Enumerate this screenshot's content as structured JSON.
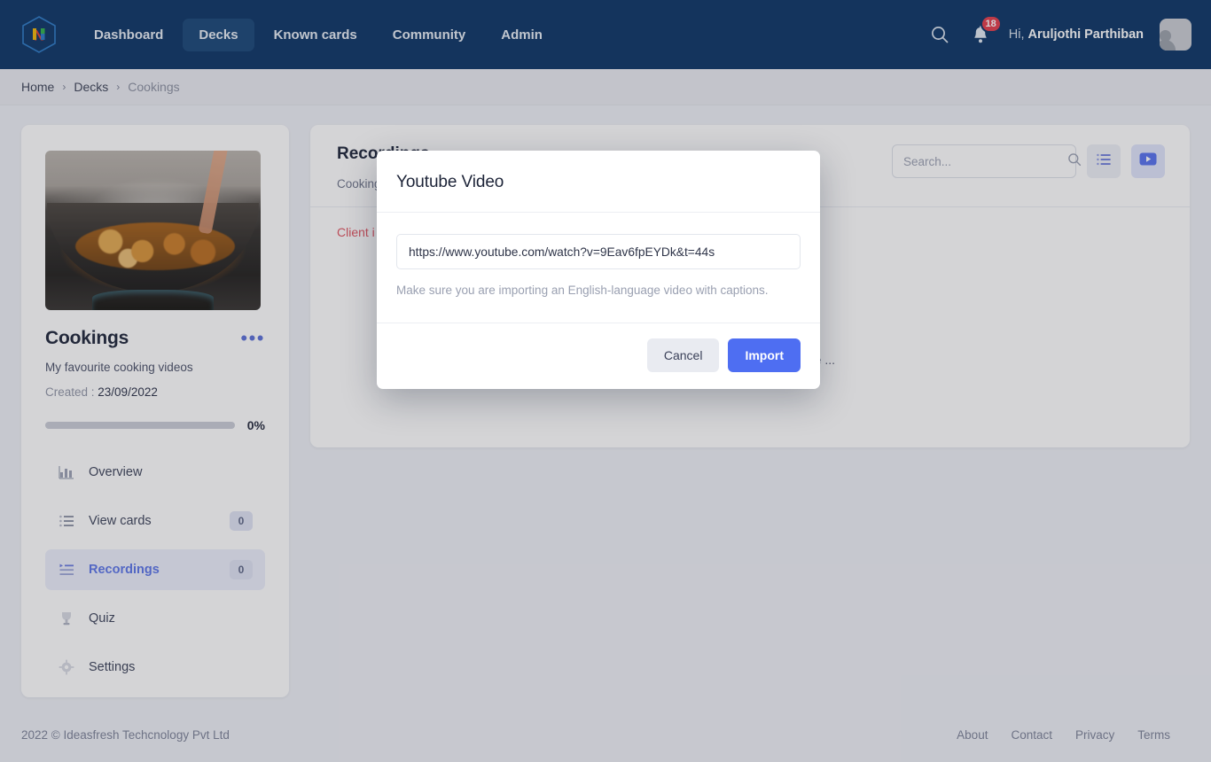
{
  "header": {
    "logo_letter": "N",
    "nav": [
      {
        "label": "Dashboard",
        "active": false
      },
      {
        "label": "Decks",
        "active": true
      },
      {
        "label": "Known cards",
        "active": false
      },
      {
        "label": "Community",
        "active": false
      },
      {
        "label": "Admin",
        "active": false
      }
    ],
    "notification_count": "18",
    "greeting_prefix": "Hi, ",
    "user_name": "Aruljothi Parthiban"
  },
  "breadcrumb": {
    "items": [
      "Home",
      "Decks",
      "Cookings"
    ],
    "separator": "›"
  },
  "sidebar": {
    "deck_title": "Cookings",
    "deck_description": "My favourite cooking videos",
    "created_label": "Created : ",
    "created_date": "23/09/2022",
    "progress_percent": "0%",
    "progress_value": 0,
    "menu": [
      {
        "label": "Overview",
        "icon": "bar-chart-icon",
        "badge": null,
        "active": false
      },
      {
        "label": "View cards",
        "icon": "list-icon",
        "badge": "0",
        "active": false
      },
      {
        "label": "Recordings",
        "icon": "playlist-icon",
        "badge": "0",
        "active": true
      },
      {
        "label": "Quiz",
        "icon": "trophy-icon",
        "badge": null,
        "active": false
      },
      {
        "label": "Settings",
        "icon": "gear-icon",
        "badge": null,
        "active": false
      }
    ]
  },
  "main": {
    "title": "Recordings",
    "subtitle": "Cooking",
    "error_text": "Client i",
    "empty_text": "ere ...",
    "search_placeholder": "Search...",
    "tools": [
      {
        "name": "list-view-button",
        "icon": "list-icon"
      },
      {
        "name": "youtube-import-button",
        "icon": "youtube-play-icon"
      }
    ]
  },
  "modal": {
    "title": "Youtube Video",
    "url_value": "https://www.youtube.com/watch?v=9Eav6fpEYDk&t=44s",
    "hint": "Make sure you are importing an English-language video with captions.",
    "cancel_label": "Cancel",
    "import_label": "Import"
  },
  "footer": {
    "copyright": "2022 © Ideasfresh Techcnology Pvt Ltd",
    "links": [
      "About",
      "Contact",
      "Privacy",
      "Terms"
    ]
  },
  "colors": {
    "header_bg": "#0a3365",
    "accent_blue": "#4e6ef2",
    "badge_red": "#e33a48",
    "error_red": "#e0525f",
    "page_bg": "#eef0f6"
  }
}
